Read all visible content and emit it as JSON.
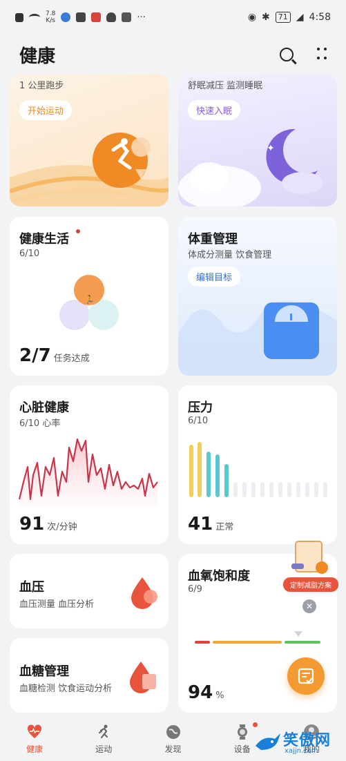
{
  "status": {
    "net_speed": "7.8\nK/s",
    "battery": "71",
    "time": "4:58"
  },
  "header": {
    "title": "健康"
  },
  "run_card": {
    "subtitle": "1 公里跑步",
    "button": "开始运动"
  },
  "sleep_card": {
    "subtitle": "舒眠减压 监测睡眠",
    "button": "快速入眠"
  },
  "life_card": {
    "title": "健康生活",
    "progress": "6/10",
    "value": "2/7",
    "unit": "任务达成"
  },
  "weight_card": {
    "title": "体重管理",
    "subtitle": "体成分测量 饮食管理",
    "button": "编辑目标"
  },
  "heart_card": {
    "title": "心脏健康",
    "progress": "6/10 心率",
    "value": "91",
    "unit": "次/分钟"
  },
  "stress_card": {
    "title": "压力",
    "progress": "6/10",
    "value": "41",
    "unit": "正常"
  },
  "bp_card": {
    "title": "血压",
    "subtitle": "血压测量 血压分析"
  },
  "spo2_card": {
    "title": "血氧饱和度",
    "progress": "6/9",
    "value": "94",
    "unit": "%"
  },
  "glucose_card": {
    "title": "血糖管理",
    "subtitle": "血糖检测 饮食运动分析"
  },
  "promo": {
    "label": "定制减脂方案"
  },
  "nav": [
    {
      "label": "健康"
    },
    {
      "label": "运动"
    },
    {
      "label": "发现"
    },
    {
      "label": "设备"
    },
    {
      "label": "我的"
    }
  ],
  "colors": {
    "accent": "#e8543b",
    "stress_yellow": "#f2cf5b",
    "stress_teal": "#5ac8cf",
    "spo2_red": "#d9443a",
    "spo2_orange": "#f0a53a",
    "spo2_green": "#5cc35b"
  },
  "watermark": {
    "text": "笑傲网",
    "url": "xajjn.com"
  }
}
